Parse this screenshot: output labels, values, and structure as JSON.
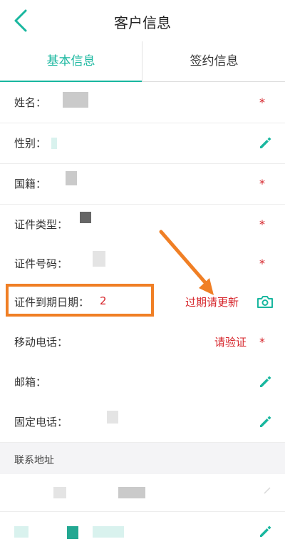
{
  "header": {
    "title": "客户信息",
    "back_icon": "chevron-left-icon"
  },
  "tabs": [
    {
      "label": "基本信息",
      "active": true
    },
    {
      "label": "签约信息",
      "active": false
    }
  ],
  "fields": {
    "name": {
      "label": "姓名："
    },
    "gender": {
      "label": "性别："
    },
    "nationality": {
      "label": "国籍："
    },
    "id_type": {
      "label": "证件类型："
    },
    "id_number": {
      "label": "证件号码："
    },
    "id_expiry": {
      "label": "证件到期日期：",
      "value": "2",
      "action": "过期请更新"
    },
    "mobile": {
      "label": "移动电话：",
      "action": "请验证"
    },
    "email": {
      "label": "邮箱："
    },
    "landline": {
      "label": "固定电话："
    }
  },
  "required_marker": "*",
  "section": {
    "title": "联系地址"
  },
  "colors": {
    "accent": "#19b79f",
    "required": "#d6242a",
    "highlight": "#f07f25"
  }
}
